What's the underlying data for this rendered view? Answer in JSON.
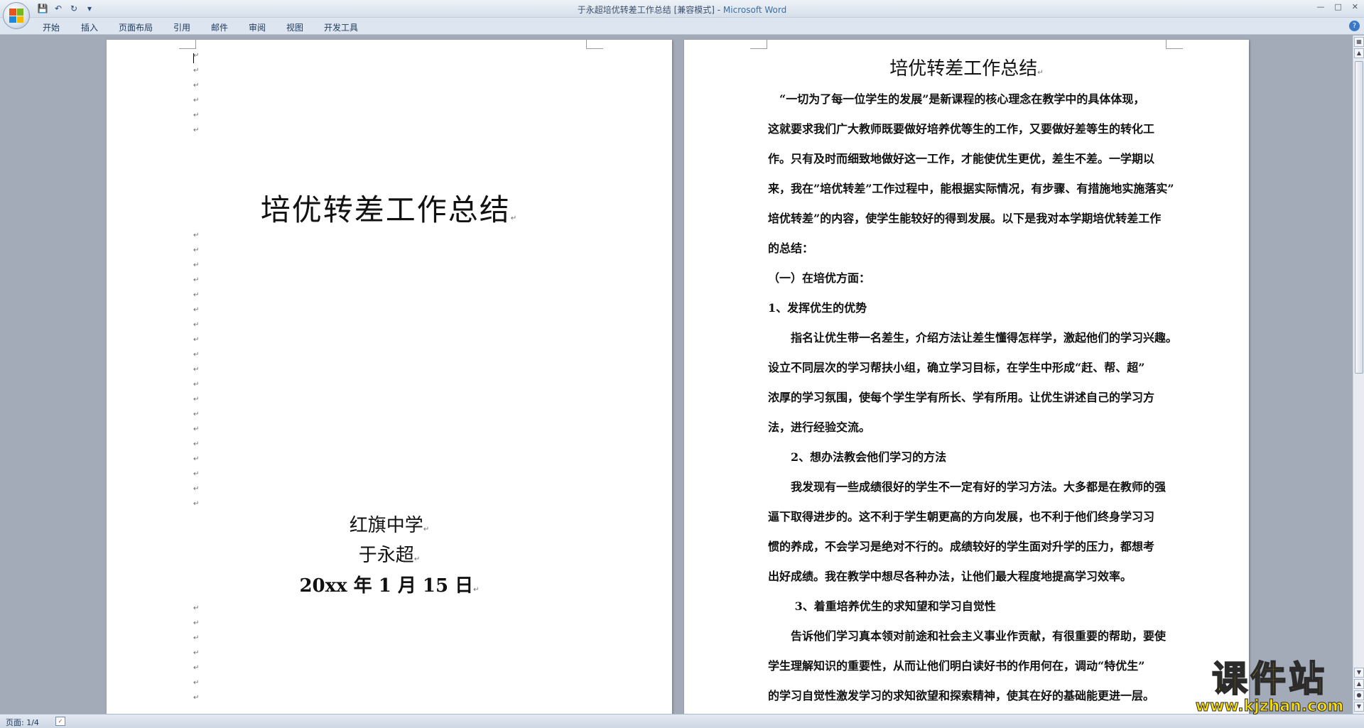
{
  "window": {
    "title_doc": "于永超培优转差工作总结 [兼容模式] - ",
    "title_app": "Microsoft Word"
  },
  "quick_access": [
    "save-icon",
    "undo-icon",
    "redo-icon",
    "customize-icon"
  ],
  "ribbon": {
    "tabs": [
      "开始",
      "插入",
      "页面布局",
      "引用",
      "邮件",
      "审阅",
      "视图",
      "开发工具"
    ]
  },
  "cover_page": {
    "title": "培优转差工作总结",
    "school": "红旗中学",
    "author": "于永超",
    "date": "20xx 年 1 月 15 日"
  },
  "content_page": {
    "title": "培优转差工作总结",
    "lines": [
      "　“一切为了每一位学生的发展”是新课程的核心理念在教学中的具体体现，",
      "这就要求我们广大教师既要做好培养优等生的工作，又要做好差等生的转化工",
      "作。只有及时而细致地做好这一工作，才能使优生更优，差生不差。一学期以",
      "来，我在”培优转差”工作过程中，能根据实际情况，有步骤、有措施地实施落实”",
      "培优转差”的内容，使学生能较好的得到发展。以下是我对本学期培优转差工作",
      "的总结：",
      "（一）在培优方面：",
      "  1、发挥优生的优势",
      "　　指名让优生带一名差生，介绍方法让差生懂得怎样学，激起他们的学习兴趣。",
      "设立不同层次的学习帮扶小组，确立学习目标，在学生中形成“赶、帮、超”",
      "浓厚的学习氛围，使每个学生学有所长、学有所用。让优生讲述自己的学习方",
      "法，进行经验交流。",
      "　　2、想办法教会他们学习的方法",
      "　　我发现有一些成绩很好的学生不一定有好的学习方法。大多都是在教师的强",
      "逼下取得进步的。这不利于学生朝更高的方向发展，也不利于他们终身学习习",
      "惯的养成，不会学习是绝对不行的。成绩较好的学生面对升学的压力，都想考",
      "出好成绩。我在教学中想尽各种办法，让他们最大程度地提高学习效率。",
      "　　 3、着重培养优生的求知望和学习自觉性",
      "　　告诉他们学习真本领对前途和社会主义事业作贡献，有很重要的帮助，要使",
      "学生理解知识的重要性，从而让他们明白读好书的作用何在，调动“特优生”",
      "的学习自觉性激发学习的求知欲望和探索精神，使其在好的基础能更进一层。"
    ]
  },
  "status": {
    "page": "页面: 1/4"
  },
  "watermark": {
    "cn": "课件站",
    "url": "www.kjzhan.com"
  },
  "colors": {
    "background": "#a4abb8",
    "ribbon": "#dde5f0",
    "app_name": "#3b6ea5",
    "watermark": "#ffe100"
  }
}
